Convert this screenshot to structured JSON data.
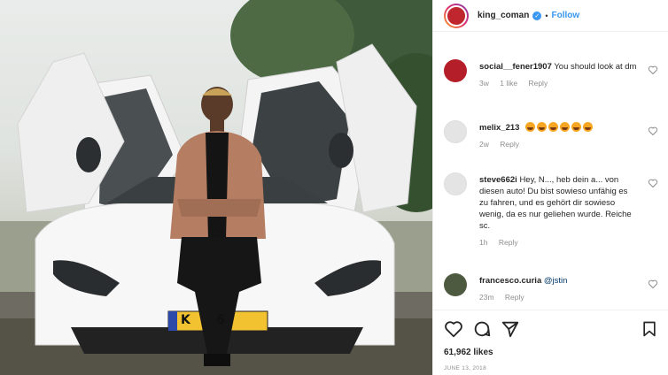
{
  "post": {
    "username": "king_coman",
    "follow_label": "Follow",
    "separator": "•",
    "verified_glyph": "✓",
    "plate_text": "K      6",
    "likes": "61,962 likes",
    "date": "JUNE 13, 2018"
  },
  "comments": [
    {
      "user": "social__fener1907",
      "text": "You should look at dm",
      "time": "3w",
      "likes": "1 like",
      "reply": "Reply"
    },
    {
      "user": "melix_213",
      "text": "",
      "emoji_count": 6,
      "time": "2w",
      "reply": "Reply"
    },
    {
      "user": "steve662i",
      "text": "Hey, N..., heb dein a... von diesen auto! Du bist sowieso unfähig es zu fahren, und es gehört dir sowieso wenig, da es nur geliehen wurde. Reiche sc.",
      "time": "1h",
      "reply": "Reply"
    },
    {
      "user": "francesco.curia",
      "mention": "@jstin",
      "time": "23m",
      "reply": "Reply"
    }
  ],
  "colors": {
    "link_blue": "#3897f0",
    "muted": "#8e8e8e",
    "text": "#262626"
  },
  "icons": [
    "heart-icon",
    "comment-icon",
    "share-icon",
    "bookmark-icon",
    "verified-icon"
  ]
}
